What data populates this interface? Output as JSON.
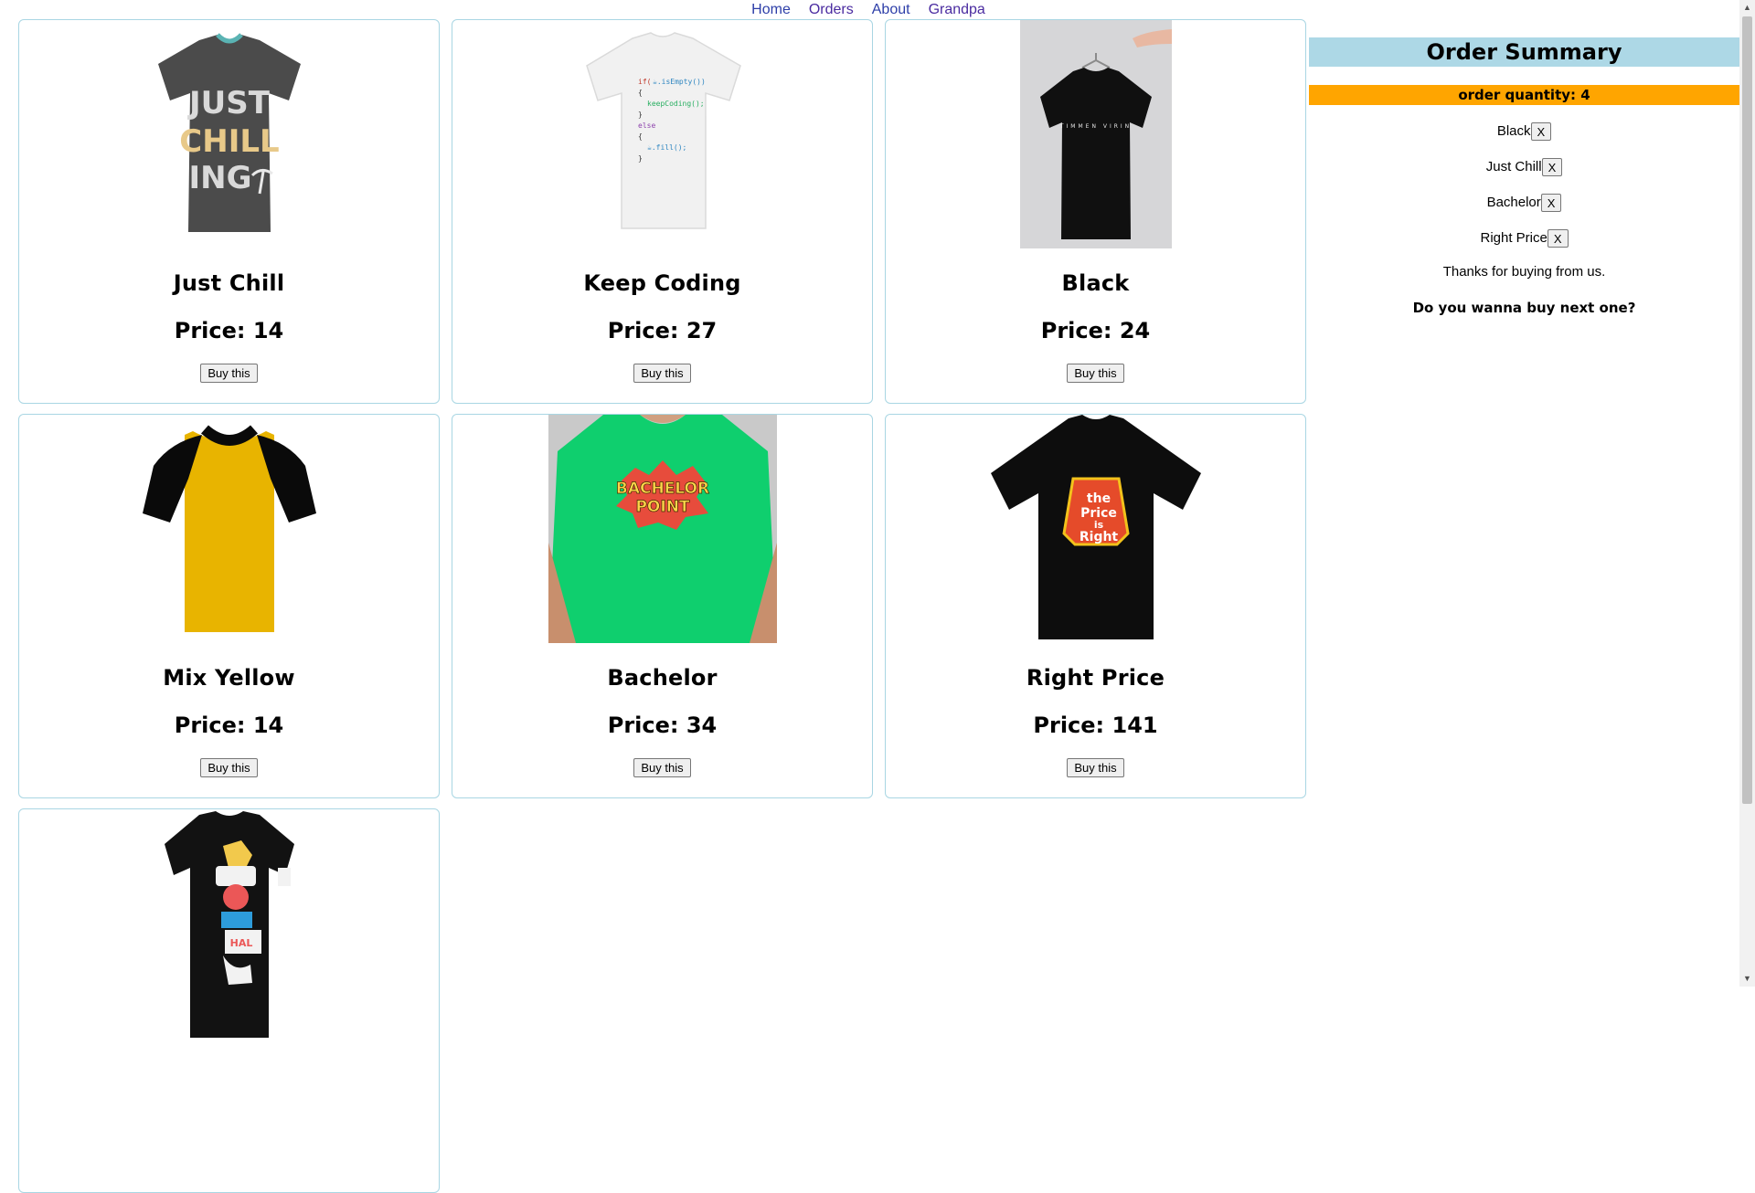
{
  "nav": {
    "items": [
      "Home",
      "Orders",
      "About",
      "Grandpa"
    ]
  },
  "products": [
    {
      "name": "Just Chill",
      "price_label": "Price: 14",
      "button": "Buy this",
      "shirt_color": "#4b4b4b",
      "print_text": "JUST CHILL ING"
    },
    {
      "name": "Keep Coding",
      "price_label": "Price: 27",
      "button": "Buy this",
      "shirt_color": "#f1f1f1",
      "print_text": "if(☕.isEmpty()) { keepCoding(); } else { ☕.fill(); }"
    },
    {
      "name": "Black",
      "price_label": "Price: 24",
      "button": "Buy this",
      "shirt_color": "#101010",
      "print_text": "TIMMEN VIRIN"
    },
    {
      "name": "Mix Yellow",
      "price_label": "Price: 14",
      "button": "Buy this",
      "shirt_color": "#e8b400"
    },
    {
      "name": "Bachelor",
      "price_label": "Price: 34",
      "button": "Buy this",
      "shirt_color": "#0fcf6e",
      "print_text": "BACHELOR POINT"
    },
    {
      "name": "Right Price",
      "price_label": "Price: 141",
      "button": "Buy this",
      "shirt_color": "#0d0d0d",
      "print_text": "the Price is Right"
    },
    {
      "name": "",
      "price_label": "",
      "button": "",
      "shirt_color": "#121212"
    }
  ],
  "summary": {
    "title": "Order Summary",
    "quantity_label": "order quantity: 4",
    "items": [
      {
        "name": "Black",
        "remove": "X"
      },
      {
        "name": "Just Chill",
        "remove": "X"
      },
      {
        "name": "Bachelor",
        "remove": "X"
      },
      {
        "name": "Right Price",
        "remove": "X"
      }
    ],
    "thanks": "Thanks for buying from us.",
    "next_prompt": "Do you wanna buy next one?"
  }
}
